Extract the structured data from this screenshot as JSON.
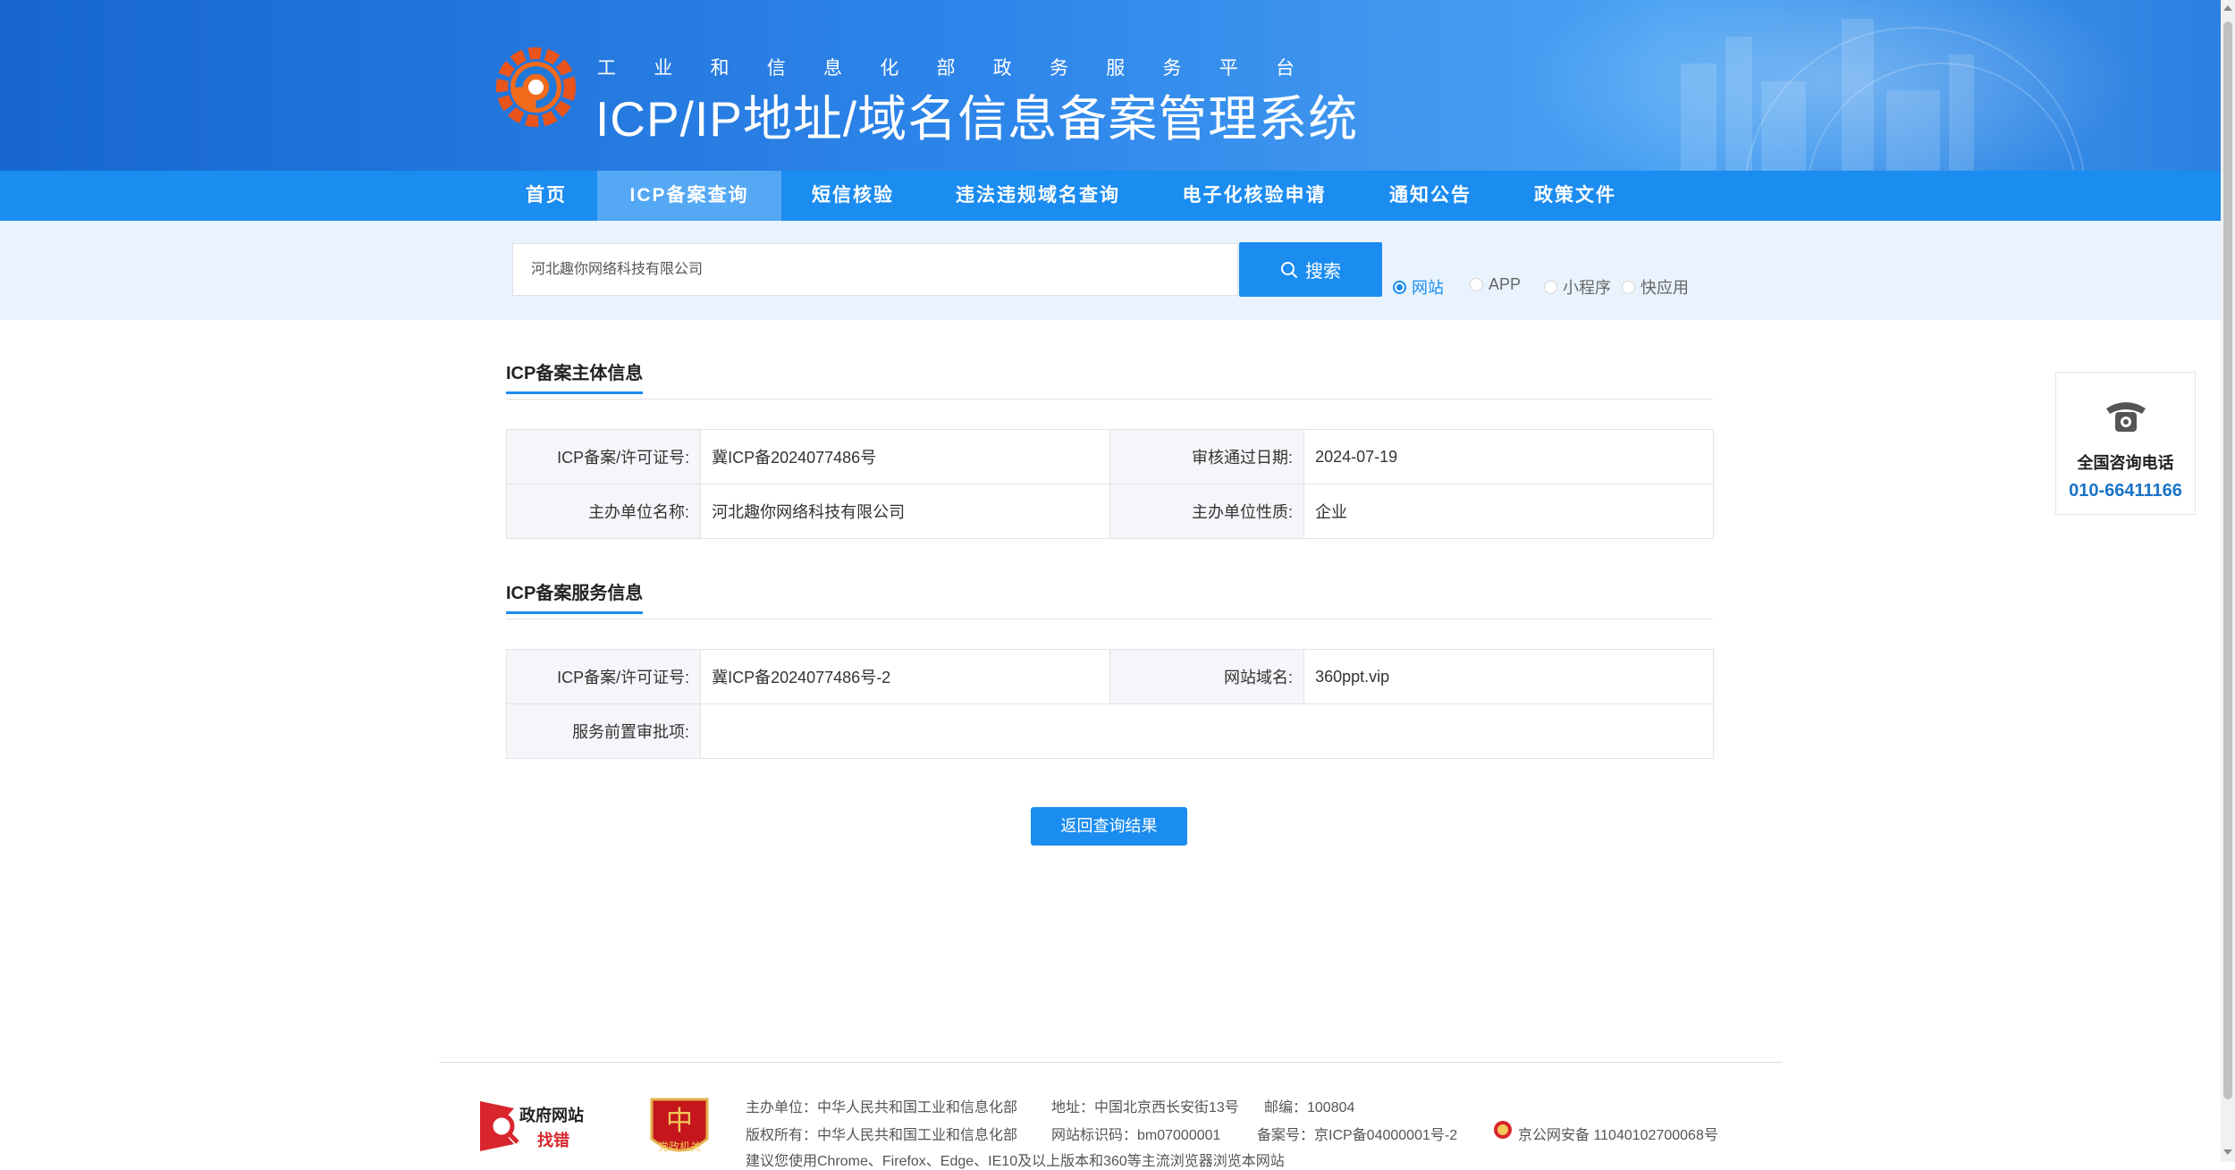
{
  "header": {
    "sub_title_chars": [
      "工",
      "业",
      "和",
      "信",
      "息",
      "化",
      "部",
      "政",
      "务",
      "服",
      "务",
      "平",
      "台"
    ],
    "main_title": "ICP/IP地址/域名信息备案管理系统"
  },
  "nav": {
    "items": [
      {
        "label": "首页"
      },
      {
        "label": "ICP备案查询",
        "active": true
      },
      {
        "label": "短信核验"
      },
      {
        "label": "违法违规域名查询"
      },
      {
        "label": "电子化核验申请"
      },
      {
        "label": "通知公告"
      },
      {
        "label": "政策文件"
      }
    ]
  },
  "search": {
    "value": "河北趣你网络科技有限公司",
    "button_label": "搜索",
    "types": [
      {
        "label": "网站",
        "checked": true
      },
      {
        "label": "APP",
        "checked": false
      },
      {
        "label": "小程序",
        "checked": false
      },
      {
        "label": "快应用",
        "checked": false
      }
    ]
  },
  "entity": {
    "title": "ICP备案主体信息",
    "license_label": "ICP备案/许可证号:",
    "license_value": "冀ICP备2024077486号",
    "date_label": "审核通过日期:",
    "date_value": "2024-07-19",
    "org_label": "主办单位名称:",
    "org_value": "河北趣你网络科技有限公司",
    "nature_label": "主办单位性质:",
    "nature_value": "企业"
  },
  "service": {
    "title": "ICP备案服务信息",
    "license_label": "ICP备案/许可证号:",
    "license_value": "冀ICP备2024077486号-2",
    "domain_label": "网站域名:",
    "domain_value": "360ppt.vip",
    "approval_label": "服务前置审批项:",
    "approval_value": ""
  },
  "back_button": "返回查询结果",
  "contact": {
    "title": "全国咨询电话",
    "number": "010-66411166"
  },
  "footer": {
    "gov_logo_text": "政府网站",
    "gov_logo_sub": "找错",
    "badge_text": "党政机关",
    "sponsor": "主办单位：中华人民共和国工业和信息化部",
    "address": "地址：中国北京西长安街13号",
    "postcode": "邮编：100804",
    "copyright": "版权所有：中华人民共和国工业和信息化部",
    "site_id": "网站标识码：bm07000001",
    "record": "备案号：京ICP备04000001号-2",
    "police": "京公网安备 11040102700068号",
    "browser_note": "建议您使用Chrome、Firefox、Edge、IE10及以上版本和360等主流浏览器浏览本网站"
  },
  "colors": {
    "primary": "#1b8cf0",
    "nav_active": "#54a8f4",
    "header_dark": "#1766cf",
    "search_band": "#e9f3fd",
    "contact_number": "#1b73c7"
  }
}
